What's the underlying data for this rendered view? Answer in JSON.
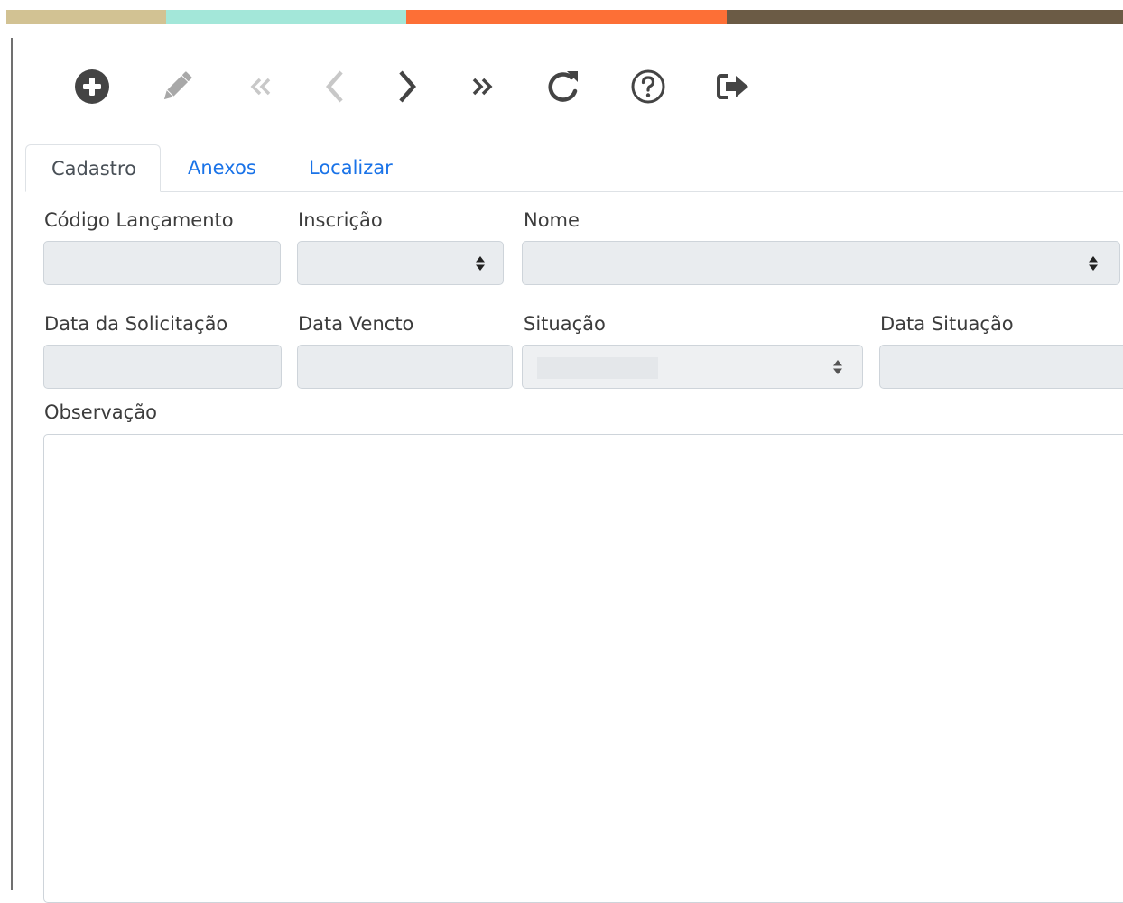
{
  "colors": {
    "bar_tan": "#d2c293",
    "bar_mint": "#a3e7d9",
    "bar_orange": "#fd6f36",
    "bar_brown": "#6b5b45",
    "icon_dark": "#444444",
    "icon_disabled": "#c8c8c8",
    "link_blue": "#1a73e8"
  },
  "toolbar": {
    "icons": [
      "plus-circle-icon",
      "pencil-icon",
      "double-chevron-left-icon",
      "chevron-left-icon",
      "chevron-right-icon",
      "double-chevron-right-icon",
      "refresh-icon",
      "help-icon",
      "sign-out-icon"
    ]
  },
  "tabs": [
    {
      "label": "Cadastro",
      "active": true
    },
    {
      "label": "Anexos",
      "active": false
    },
    {
      "label": "Localizar",
      "active": false
    }
  ],
  "form": {
    "codigo_lancamento": {
      "label": "Código Lançamento",
      "value": ""
    },
    "inscricao": {
      "label": "Inscrição",
      "value": ""
    },
    "nome": {
      "label": "Nome",
      "value": ""
    },
    "data_solicitacao": {
      "label": "Data da Solicitação",
      "value": ""
    },
    "data_vencto": {
      "label": "Data Vencto",
      "value": ""
    },
    "situacao": {
      "label": "Situação",
      "value": ""
    },
    "data_situacao": {
      "label": "Data Situação",
      "value": ""
    },
    "observacao": {
      "label": "Observação",
      "value": ""
    }
  }
}
